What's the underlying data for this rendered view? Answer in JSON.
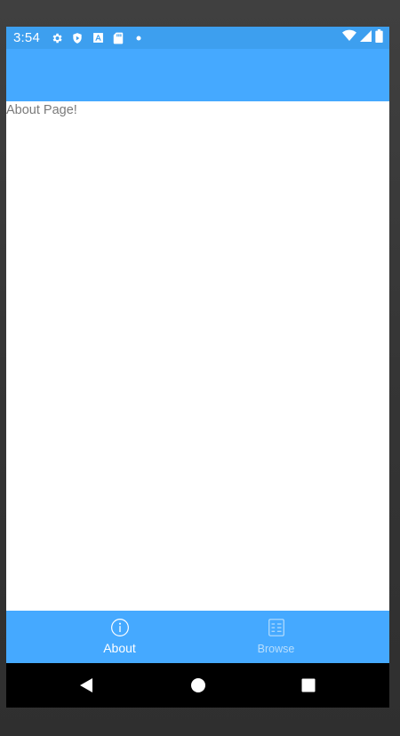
{
  "status_bar": {
    "time": "3:54",
    "left_icons": [
      "gear-icon",
      "play-protect-icon",
      "text-a-icon",
      "sd-card-icon",
      "dot-icon"
    ],
    "right_icons": [
      "wifi-icon",
      "cell-signal-icon",
      "battery-icon"
    ]
  },
  "content": {
    "text": "About Page!"
  },
  "tabs": [
    {
      "label": "About",
      "icon": "info-icon",
      "active": true
    },
    {
      "label": "Browse",
      "icon": "list-icon",
      "active": false
    }
  ],
  "nav": {
    "buttons": [
      "back-icon",
      "home-icon",
      "recents-icon"
    ]
  },
  "colors": {
    "status_bar": "#3d9fef",
    "app_bar": "#45a9ff",
    "tab_bar": "#45a9ff",
    "tab_inactive_text": "#b8defc",
    "content_text": "#7a7a7a"
  }
}
